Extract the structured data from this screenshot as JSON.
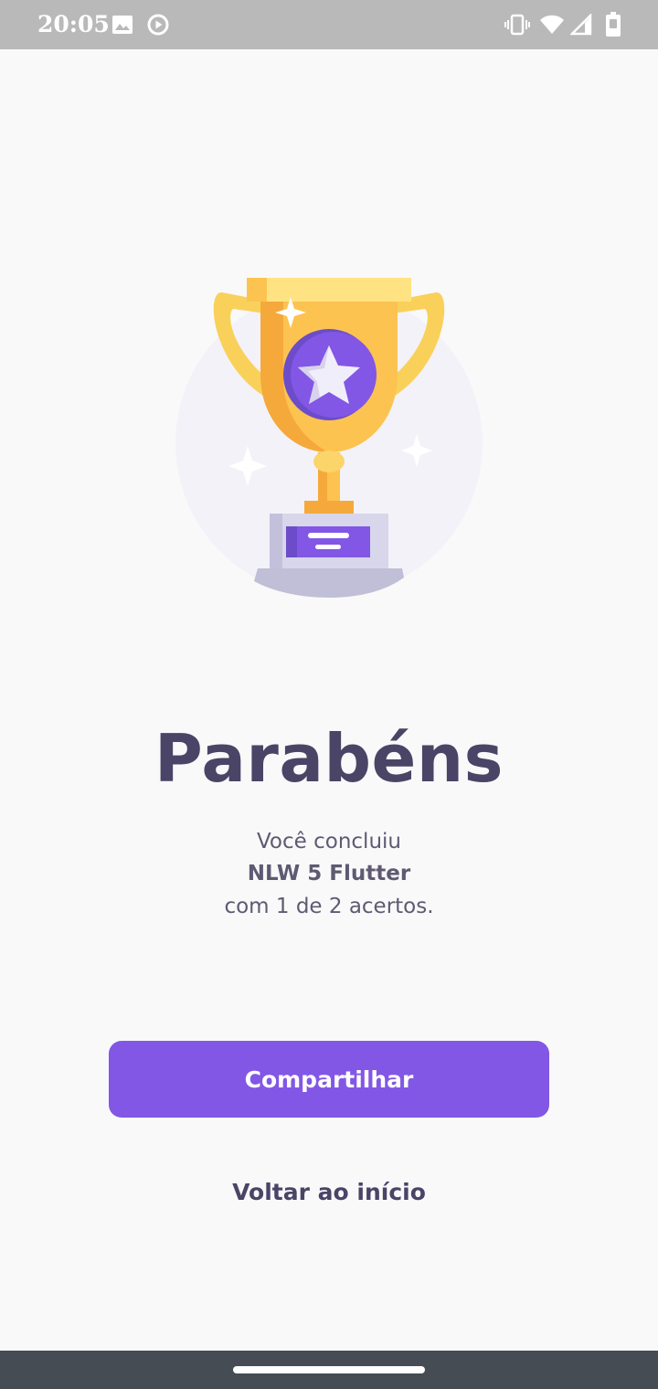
{
  "status_bar": {
    "time": "20:05",
    "left_icons": [
      "image-icon",
      "play-circle-icon"
    ],
    "right_icons": [
      "vibrate-icon",
      "wifi-icon",
      "signal-icon",
      "battery-icon"
    ]
  },
  "illustration": {
    "name": "trophy-icon"
  },
  "result": {
    "title": "Parabéns",
    "line1": "Você concluiu",
    "quiz_name": "NLW 5 Flutter",
    "line3": "com 1 de 2 acertos."
  },
  "actions": {
    "share_label": "Compartilhar",
    "home_label": "Voltar ao início"
  },
  "colors": {
    "accent": "#8257e5",
    "title": "#4a4466",
    "background": "#f9f9fa"
  }
}
